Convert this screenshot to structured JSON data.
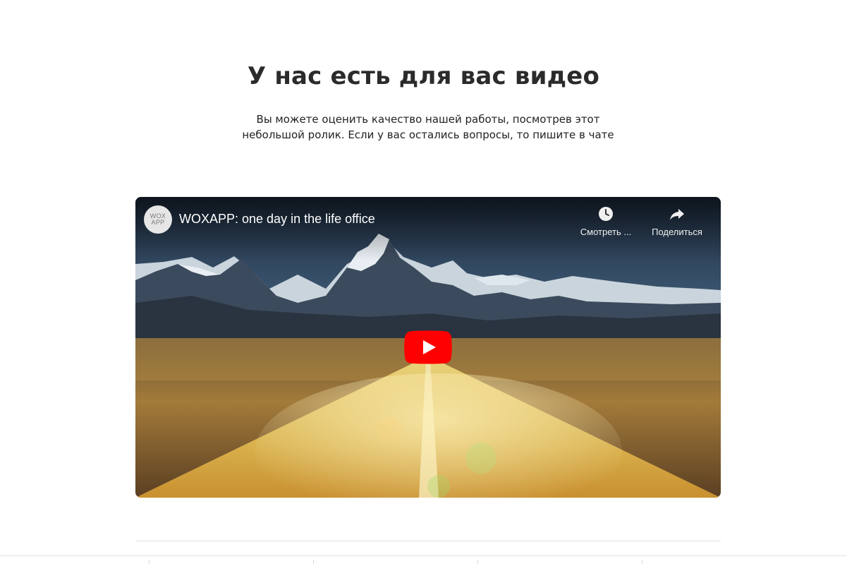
{
  "section": {
    "heading": "У нас есть для вас видео",
    "description": "Вы можете оценить качество нашей работы, посмотрев этот небольшой ролик. Если у вас остались вопросы, то пишите в чате"
  },
  "video": {
    "channel_logo_line1": "WOX",
    "channel_logo_line2": "APP",
    "title": "WOXAPP: one day in the life office",
    "watch_later_label": "Смотреть ...",
    "share_label": "Поделиться",
    "play_button_color": "#ff0000",
    "icons": {
      "watch_later": "clock-icon",
      "share": "share-arrow-icon",
      "play": "play-icon"
    }
  }
}
